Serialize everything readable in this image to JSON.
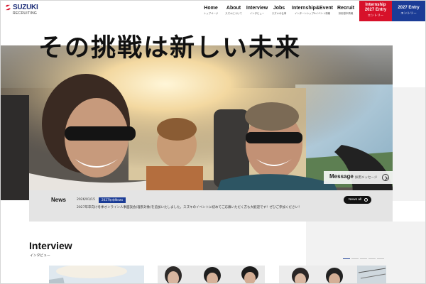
{
  "header": {
    "logo_text": "SUZUKI",
    "logo_sub": "RECRUITING",
    "nav": [
      {
        "en": "Home",
        "jp": "トップページ"
      },
      {
        "en": "About",
        "jp": "スズキについて"
      },
      {
        "en": "Interview",
        "jp": "インタビュー"
      },
      {
        "en": "Jobs",
        "jp": "スズキの仕事"
      },
      {
        "en": "Internship&Event",
        "jp": "インターンシップ&イベント情報"
      },
      {
        "en": "Recruit",
        "jp": "採用基本情報"
      }
    ],
    "entry_internship": {
      "title_line1": "Internship",
      "title_line2": "2027 Entry",
      "sub": "エントリー"
    },
    "entry_main": {
      "title": "2027 Entry",
      "sub": "エントリー"
    }
  },
  "hero": {
    "title": "その挑戦は新しい未来",
    "message_label": "Message",
    "message_sub": "採用メッセージ"
  },
  "news": {
    "label": "News",
    "date": "2026/01/15",
    "badge": "2027年卒News",
    "text": "2027年卒向け冬季オンライン人事面談会(理系対象)を追加いたしました。スズキのイベントに初めてご応募いただく方も大歓迎です！ぜひご参加ください！",
    "all_label": "News all"
  },
  "interview": {
    "title": "Interview",
    "sub": "インタビュー"
  },
  "colors": {
    "brand_red": "#d7112a",
    "brand_blue": "#1b3c96"
  }
}
